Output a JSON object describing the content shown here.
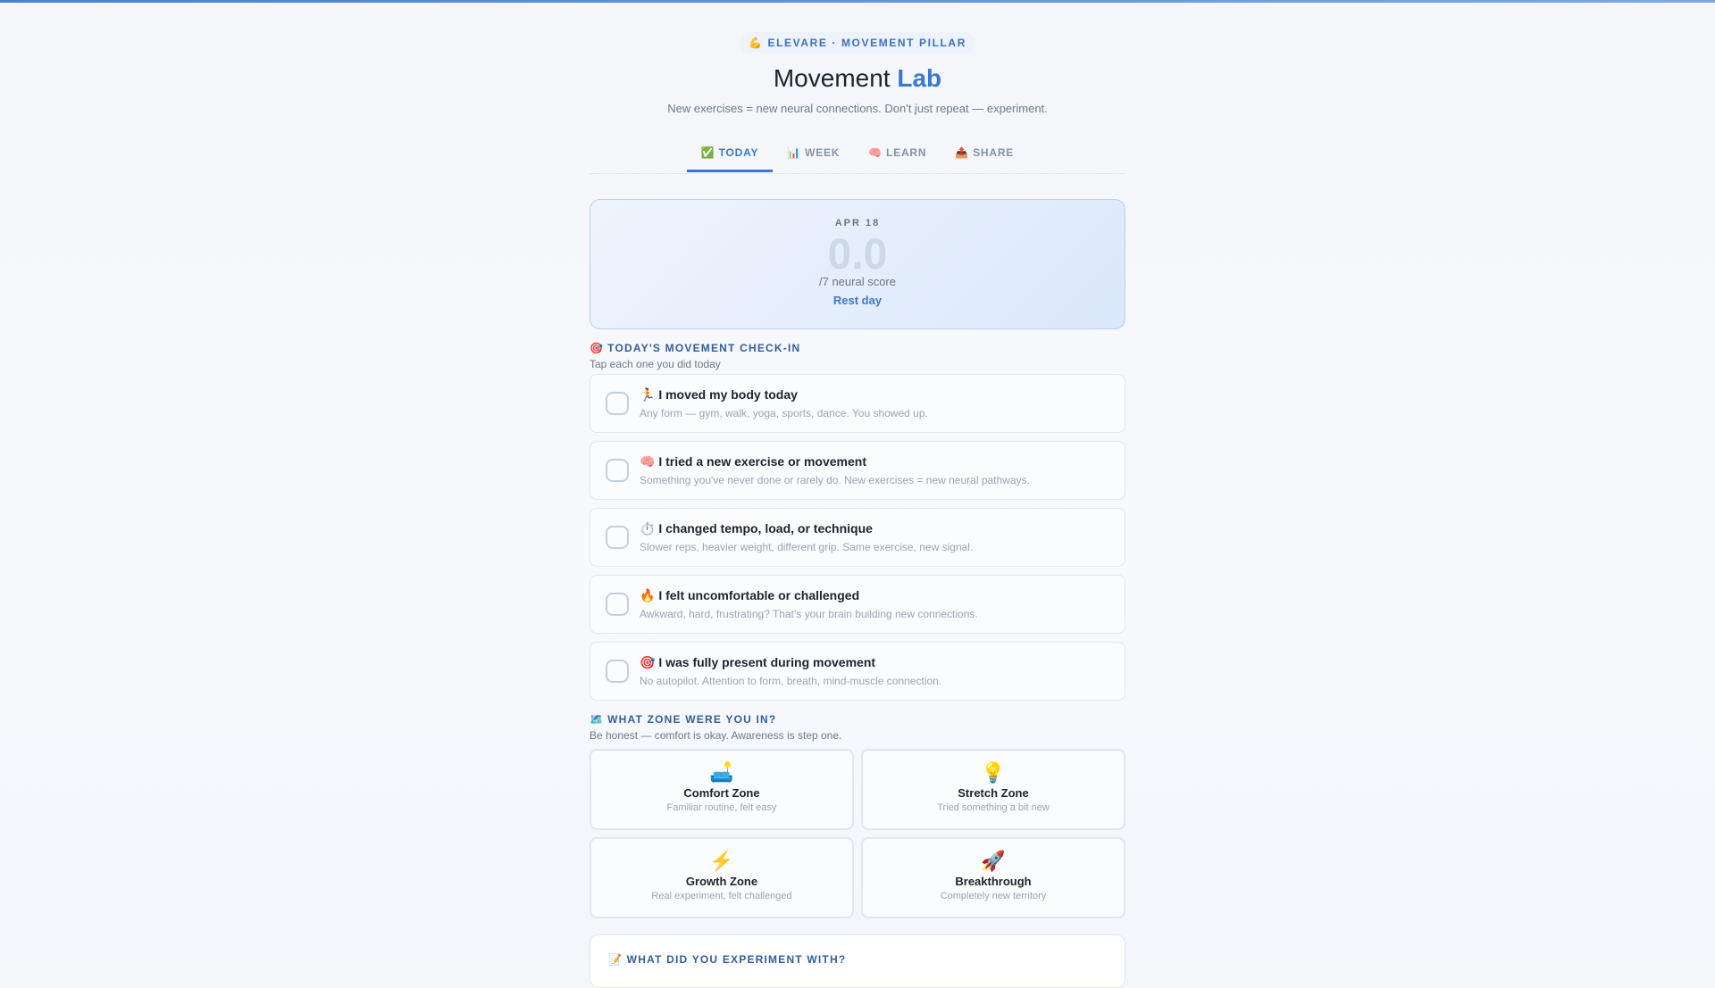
{
  "header": {
    "pill": "💪 ELEVARE · MOVEMENT PILLAR",
    "title_main": "Movement",
    "title_accent": "Lab",
    "subtitle": "New exercises = new neural connections. Don't just repeat — experiment."
  },
  "tabs": [
    {
      "icon": "✅",
      "label": "TODAY",
      "active": true
    },
    {
      "icon": "📊",
      "label": "WEEK",
      "active": false
    },
    {
      "icon": "🧠",
      "label": "LEARN",
      "active": false
    },
    {
      "icon": "📤",
      "label": "SHARE",
      "active": false
    }
  ],
  "scorecard": {
    "date": "APR 18",
    "score": "0.0",
    "score_label": "/7 neural score",
    "status": "Rest day"
  },
  "checkin": {
    "icon": "🎯",
    "title": "TODAY'S MOVEMENT CHECK-IN",
    "subtitle": "Tap each one you did today",
    "items": [
      {
        "title": "🏃 I moved my body today",
        "desc": "Any form — gym, walk, yoga, sports, dance. You showed up."
      },
      {
        "title": "🧠 I tried a new exercise or movement",
        "desc": "Something you've never done or rarely do. New exercises = new neural pathways."
      },
      {
        "title": "⏱️ I changed tempo, load, or technique",
        "desc": "Slower reps, heavier weight, different grip. Same exercise, new signal."
      },
      {
        "title": "🔥 I felt uncomfortable or challenged",
        "desc": "Awkward, hard, frustrating? That's your brain building new connections."
      },
      {
        "title": "🎯 I was fully present during movement",
        "desc": "No autopilot. Attention to form, breath, mind-muscle connection."
      }
    ]
  },
  "zones": {
    "icon": "🗺️",
    "title": "WHAT ZONE WERE YOU IN?",
    "subtitle": "Be honest — comfort is okay. Awareness is step one.",
    "items": [
      {
        "icon": "🛋️",
        "name": "Comfort Zone",
        "desc": "Familiar routine, felt easy"
      },
      {
        "icon": "💡",
        "name": "Stretch Zone",
        "desc": "Tried something a bit new"
      },
      {
        "icon": "⚡",
        "name": "Growth Zone",
        "desc": "Real experiment, felt challenged"
      },
      {
        "icon": "🚀",
        "name": "Breakthrough",
        "desc": "Completely new territory"
      }
    ]
  },
  "experiment": {
    "title": "📝 WHAT DID YOU EXPERIMENT WITH?"
  }
}
